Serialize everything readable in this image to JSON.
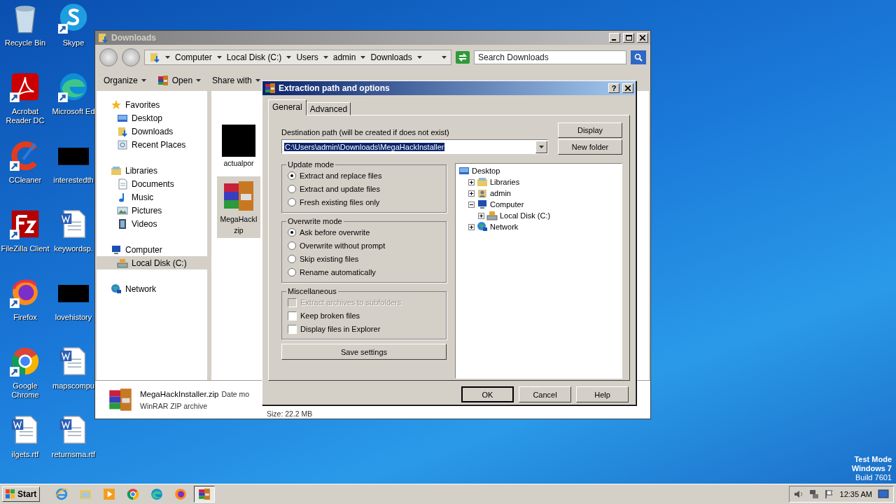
{
  "desktop": {
    "icons": [
      {
        "label": "Recycle Bin",
        "kind": "recycle",
        "shortcut": false
      },
      {
        "label": "Skype",
        "kind": "skype",
        "shortcut": true
      },
      {
        "label": "Acrobat Reader DC",
        "kind": "pdf",
        "shortcut": true
      },
      {
        "label": "Microsoft Ed",
        "kind": "edge",
        "shortcut": true
      },
      {
        "label": "CCleaner",
        "kind": "ccleaner",
        "shortcut": true
      },
      {
        "label": "interestedth",
        "kind": "black",
        "shortcut": false
      },
      {
        "label": "FileZilla Client",
        "kind": "filezilla",
        "shortcut": true
      },
      {
        "label": "keywordsp.",
        "kind": "word",
        "shortcut": false
      },
      {
        "label": "Firefox",
        "kind": "firefox",
        "shortcut": true
      },
      {
        "label": "lovehistory",
        "kind": "black",
        "shortcut": false
      },
      {
        "label": "Google Chrome",
        "kind": "chrome",
        "shortcut": true
      },
      {
        "label": "mapscompu",
        "kind": "word",
        "shortcut": false
      },
      {
        "label": "ilgets.rtf",
        "kind": "word",
        "shortcut": false
      },
      {
        "label": "returnsma.rtf",
        "kind": "word",
        "shortcut": false
      }
    ],
    "notice": [
      "Test Mode",
      "Windows 7",
      "Build 7601"
    ]
  },
  "explorer": {
    "title": "Downloads",
    "breadcrumb": [
      "Computer",
      "Local Disk (C:)",
      "Users",
      "admin",
      "Downloads"
    ],
    "search": {
      "placeholder": "Search Downloads"
    },
    "toolbar": [
      {
        "label": "Organize",
        "kind": "plain"
      },
      {
        "label": "Open",
        "kind": "winrar"
      },
      {
        "label": "Share with",
        "kind": "plain"
      }
    ],
    "nav": [
      {
        "label": "Favorites",
        "kind": "star",
        "selected": false,
        "children": [
          {
            "label": "Desktop",
            "kind": "desktop",
            "selected": false
          },
          {
            "label": "Downloads",
            "kind": "download",
            "selected": false
          },
          {
            "label": "Recent Places",
            "kind": "recent",
            "selected": false
          }
        ]
      },
      {
        "label": "Libraries",
        "kind": "library",
        "selected": false,
        "children": [
          {
            "label": "Documents",
            "kind": "document",
            "selected": false
          },
          {
            "label": "Music",
            "kind": "music",
            "selected": false
          },
          {
            "label": "Pictures",
            "kind": "pictures",
            "selected": false
          },
          {
            "label": "Videos",
            "kind": "videos",
            "selected": false
          }
        ]
      },
      {
        "label": "Computer",
        "kind": "computer",
        "selected": false,
        "children": [
          {
            "label": "Local Disk (C:)",
            "kind": "disk",
            "selected": true
          }
        ]
      },
      {
        "label": "Network",
        "kind": "network",
        "selected": false
      }
    ],
    "files": [
      {
        "lines": [
          "actualpor"
        ],
        "kind": "black",
        "selected": false
      },
      {
        "lines": [
          "MegaHackI",
          "zip"
        ],
        "kind": "winrar",
        "selected": true
      }
    ],
    "details": {
      "name": "MegaHackInstaller.zip",
      "date": "Date mo",
      "type": "WinRAR ZIP archive",
      "size": "Size: 22.2 MB"
    }
  },
  "dialog": {
    "title": "Extraction path and options",
    "help": "?",
    "tabs": [
      {
        "label": "General",
        "selected": true
      },
      {
        "label": "Advanced",
        "selected": false
      }
    ],
    "destination": {
      "label": "Destination path (will be created if does not exist)",
      "value": "C:\\Users\\admin\\Downloads\\MegaHackInstaller"
    },
    "side_buttons": [
      "Display",
      "New folder"
    ],
    "groups": [
      {
        "title": "Update mode",
        "kind": "radio",
        "options": [
          {
            "label": "Extract and replace files",
            "selected": true
          },
          {
            "label": "Extract and update files",
            "selected": false
          },
          {
            "label": "Fresh existing files only",
            "selected": false
          }
        ]
      },
      {
        "title": "Overwrite mode",
        "kind": "radio",
        "options": [
          {
            "label": "Ask before overwrite",
            "selected": true
          },
          {
            "label": "Overwrite without prompt",
            "selected": false
          },
          {
            "label": "Skip existing files",
            "selected": false
          },
          {
            "label": "Rename automatically",
            "selected": false
          }
        ]
      },
      {
        "title": "Miscellaneous",
        "kind": "checkbox",
        "options": [
          {
            "label": "Extract archives to subfolders",
            "checked": false,
            "disabled": true
          },
          {
            "label": "Keep broken files",
            "checked": false,
            "disabled": false
          },
          {
            "label": "Display files in Explorer",
            "checked": false,
            "disabled": false
          }
        ]
      }
    ],
    "save_button": "Save settings",
    "tree": [
      {
        "label": "Desktop",
        "kind": "desktop",
        "children": [
          {
            "label": "Libraries",
            "kind": "library",
            "expanded": false
          },
          {
            "label": "admin",
            "kind": "user",
            "expanded": false
          },
          {
            "label": "Computer",
            "kind": "computer",
            "expanded": true,
            "children": [
              {
                "label": "Local Disk (C:)",
                "kind": "disk",
                "expanded": false
              }
            ]
          },
          {
            "label": "Network",
            "kind": "network",
            "expanded": false
          }
        ]
      }
    ],
    "buttons": [
      {
        "label": "OK",
        "default": true
      },
      {
        "label": "Cancel",
        "default": false
      },
      {
        "label": "Help",
        "default": false
      }
    ]
  },
  "taskbar": {
    "start": "Start",
    "apps": [
      {
        "kind": "ie",
        "active": false
      },
      {
        "kind": "folder",
        "active": false
      },
      {
        "kind": "media",
        "active": false
      },
      {
        "kind": "chrome",
        "active": false
      },
      {
        "kind": "edge",
        "active": false
      },
      {
        "kind": "firefox",
        "active": false
      },
      {
        "kind": "winrar",
        "active": true
      }
    ],
    "time": "12:35 AM"
  }
}
